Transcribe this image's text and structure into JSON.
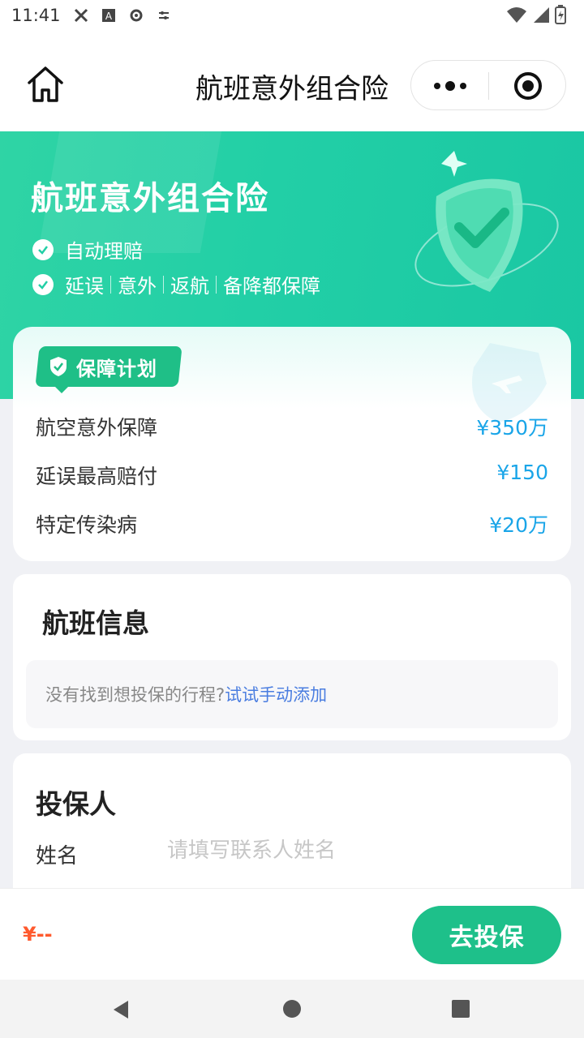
{
  "status_bar": {
    "time": "11:41",
    "icons": [
      "accessibility-icon",
      "font-icon",
      "settings-icon",
      "equalizer-icon"
    ],
    "right_icons": [
      "wifi-icon",
      "signal-icon",
      "battery-icon"
    ]
  },
  "navbar": {
    "title": "航班意外组合险",
    "home_icon": "home-icon",
    "more_icon": "more-icon",
    "close_icon": "target-icon"
  },
  "hero": {
    "title": "航班意外组合险",
    "line1": "自动理赔",
    "line2_items": [
      "延误",
      "意外",
      "返航",
      "备降都保障"
    ]
  },
  "plan": {
    "tag": "保障计划",
    "rows": [
      {
        "label": "航空意外保障",
        "value": "¥350万"
      },
      {
        "label": "延误最高赔付",
        "value": "¥150"
      },
      {
        "label": "特定传染病",
        "value": "¥20万"
      }
    ]
  },
  "flight": {
    "title": "航班信息",
    "hint": "没有找到想投保的行程?",
    "link": "试试手动添加"
  },
  "applicant": {
    "title": "投保人",
    "name_label": "姓名",
    "name_placeholder": "请填写联系人姓名",
    "name_value": ""
  },
  "bottom": {
    "price": "¥--",
    "buy_label": "去投保"
  },
  "colors": {
    "brand_green": "#1ec08a",
    "hero_green": "#22cfa6",
    "value_blue": "#1aa5e8",
    "link_blue": "#4a7de0",
    "price_orange": "#ff5a2e"
  }
}
